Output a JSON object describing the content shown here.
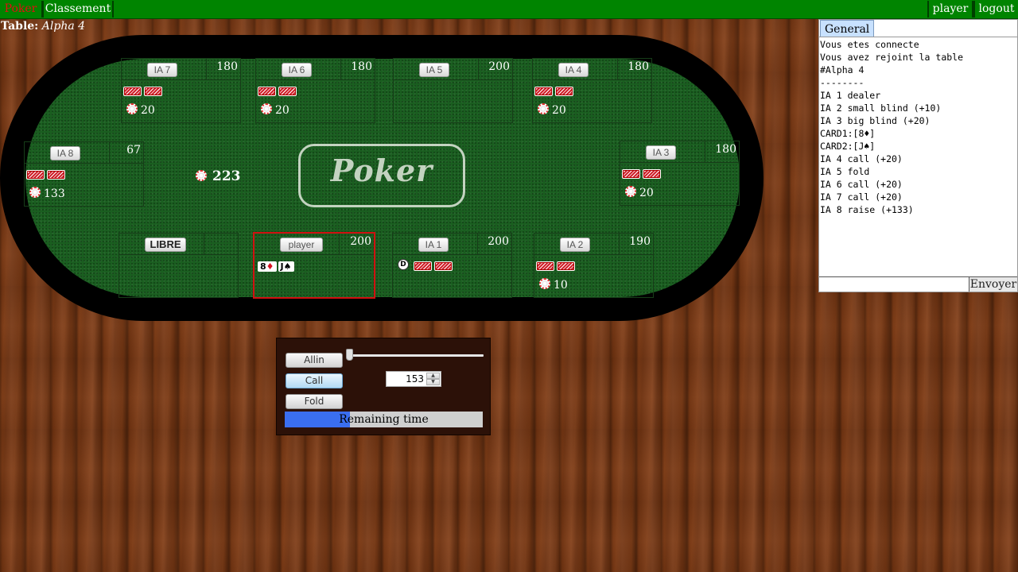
{
  "nav": {
    "brand": "Poker",
    "ranking": "Classement",
    "user": "player",
    "logout": "logout"
  },
  "table": {
    "label_prefix": "Table:",
    "name": "Alpha 4",
    "logo": "Poker",
    "pot": "223"
  },
  "seats": [
    {
      "name": "IA 7",
      "stack": "180",
      "bet": "20",
      "cards": "back"
    },
    {
      "name": "IA 6",
      "stack": "180",
      "bet": "20",
      "cards": "back"
    },
    {
      "name": "IA 5",
      "stack": "200",
      "bet": "",
      "cards": "none"
    },
    {
      "name": "IA 4",
      "stack": "180",
      "bet": "20",
      "cards": "back"
    },
    {
      "name": "IA 8",
      "stack": "67",
      "bet": "133",
      "cards": "back"
    },
    {
      "name": "IA 3",
      "stack": "180",
      "bet": "20",
      "cards": "back"
    },
    {
      "name": "LIBRE",
      "stack": "",
      "bet": "",
      "cards": "none"
    },
    {
      "name": "player",
      "stack": "200",
      "bet": "",
      "cards": "face",
      "card1": {
        "rank": "8",
        "suit": "♦"
      },
      "card2": {
        "rank": "J",
        "suit": "♠"
      },
      "active": true
    },
    {
      "name": "IA 1",
      "stack": "200",
      "bet": "",
      "cards": "back",
      "dealer": "D"
    },
    {
      "name": "IA 2",
      "stack": "190",
      "bet": "10",
      "cards": "back"
    }
  ],
  "actions": {
    "allin": "Allin",
    "call": "Call",
    "fold": "Fold",
    "bet_amount": "153",
    "slider_level": 0.0,
    "timer_label": "Remaining time",
    "timer_fraction": 0.33
  },
  "chat": {
    "tab": "General",
    "messages": [
      "Vous etes connecte",
      "Vous avez rejoint la table",
      "#Alpha 4",
      "--------",
      "IA 1 dealer",
      "IA 2 small blind (+10)",
      "IA 3 big blind (+20)",
      "CARD1:[8♦]",
      "CARD2:[J♠]",
      "IA 4 call (+20)",
      "IA 5 fold",
      "IA 6 call (+20)",
      "IA 7 call (+20)",
      "IA 8 raise (+133)"
    ],
    "send": "Envoyer",
    "input_value": ""
  },
  "colors": {
    "felt": "#1a5e20",
    "rail": "#000000",
    "nav": "#008400",
    "brand": "#e01010",
    "timer": "#3a6ef0",
    "active_seat": "#d01010"
  }
}
